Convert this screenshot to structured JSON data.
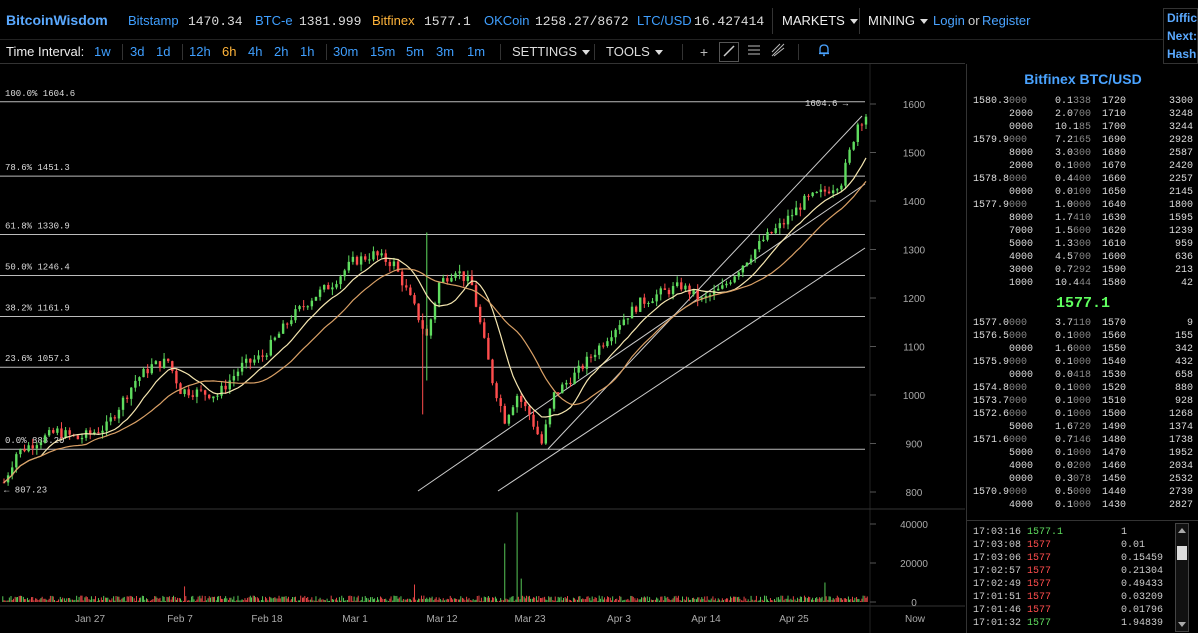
{
  "topbar": {
    "brand": "BitcoinWisdom",
    "exchanges": [
      {
        "name": "Bitstamp",
        "value": "1470.34",
        "active": false
      },
      {
        "name": "BTC-e",
        "value": "1381.999",
        "active": false
      },
      {
        "name": "Bitfinex",
        "value": "1577.1",
        "active": true
      },
      {
        "name": "OKCoin",
        "value": "1258.27/8672",
        "active": false
      },
      {
        "name": "LTC/USD",
        "value": "16.427414",
        "active": false
      }
    ],
    "markets_label": "MARKETS",
    "mining_label": "MINING",
    "login_label": "Login",
    "or_label": "or",
    "register_label": "Register",
    "difficulty_lines": [
      "Difficulty",
      "Next:",
      "Hash"
    ]
  },
  "timebar": {
    "label": "Time Interval:",
    "groups": [
      [
        "1w"
      ],
      [
        "3d",
        "1d"
      ],
      [
        "12h",
        "6h",
        "4h",
        "2h",
        "1h"
      ],
      [
        "30m",
        "15m",
        "5m",
        "3m",
        "1m"
      ]
    ],
    "active": "6h",
    "settings_label": "SETTINGS",
    "tools_label": "TOOLS"
  },
  "chart_data": {
    "type": "candlestick",
    "price_axis": {
      "min": 800,
      "max": 1600,
      "ticks": [
        1600,
        1500,
        1400,
        1300,
        1200,
        1100,
        1000,
        900,
        800
      ]
    },
    "volume_axis": {
      "min": 0,
      "max": 40000,
      "ticks": [
        40000,
        20000,
        0
      ]
    },
    "x_labels": [
      "Jan 27",
      "Feb 7",
      "Feb 18",
      "Mar 1",
      "Mar 12",
      "Mar 23",
      "Apr 3",
      "Apr 14",
      "Apr 25",
      "Now"
    ],
    "fib_levels": [
      {
        "label": "100.0% 1604.6",
        "price": 1604.6
      },
      {
        "label": "78.6% 1451.3",
        "price": 1451.3
      },
      {
        "label": "61.8% 1330.9",
        "price": 1330.9
      },
      {
        "label": "50.0% 1246.4",
        "price": 1246.4
      },
      {
        "label": "38.2% 1161.9",
        "price": 1161.9
      },
      {
        "label": "23.6% 1057.3",
        "price": 1057.3
      },
      {
        "label": "0.0% 888.20",
        "price": 888.2
      }
    ],
    "high_marker": "1604.6",
    "low_marker": "807.23",
    "price_path": [
      [
        0,
        820
      ],
      [
        3,
        880
      ],
      [
        8,
        905
      ],
      [
        13,
        925
      ],
      [
        18,
        910
      ],
      [
        25,
        935
      ],
      [
        32,
        1030
      ],
      [
        36,
        1060
      ],
      [
        40,
        1070
      ],
      [
        43,
        1010
      ],
      [
        48,
        1005
      ],
      [
        52,
        1000
      ],
      [
        58,
        1060
      ],
      [
        63,
        1080
      ],
      [
        70,
        1160
      ],
      [
        75,
        1200
      ],
      [
        80,
        1230
      ],
      [
        85,
        1275
      ],
      [
        90,
        1290
      ],
      [
        95,
        1270
      ],
      [
        100,
        1180
      ],
      [
        103,
        1120
      ],
      [
        106,
        1230
      ],
      [
        110,
        1260
      ],
      [
        114,
        1225
      ],
      [
        119,
        1030
      ],
      [
        122,
        950
      ],
      [
        125,
        1000
      ],
      [
        128,
        960
      ],
      [
        131,
        900
      ],
      [
        134,
        1000
      ],
      [
        140,
        1050
      ],
      [
        145,
        1100
      ],
      [
        150,
        1150
      ],
      [
        155,
        1190
      ],
      [
        160,
        1210
      ],
      [
        165,
        1225
      ],
      [
        170,
        1195
      ],
      [
        175,
        1220
      ],
      [
        180,
        1270
      ],
      [
        185,
        1320
      ],
      [
        190,
        1355
      ],
      [
        195,
        1400
      ],
      [
        200,
        1420
      ],
      [
        204,
        1440
      ],
      [
        208,
        1560
      ],
      [
        210,
        1577
      ]
    ],
    "volume_spikes": [
      [
        44,
        8000
      ],
      [
        100,
        9000
      ],
      [
        122,
        30000
      ],
      [
        125,
        46000
      ],
      [
        126,
        12000
      ],
      [
        200,
        10000
      ]
    ]
  },
  "book": {
    "title": "Bitfinex BTC/USD",
    "asks": [
      [
        "1580.3",
        "000",
        "0.1338",
        "1720",
        "3300"
      ],
      [
        "",
        "2000",
        "2.0700",
        "1710",
        "3248"
      ],
      [
        "",
        "0000",
        "10.185",
        "1700",
        "3244"
      ],
      [
        "1579.9",
        "000",
        "7.2165",
        "1690",
        "2928"
      ],
      [
        "",
        "8000",
        "3.0300",
        "1680",
        "2587"
      ],
      [
        "",
        "2000",
        "0.1000",
        "1670",
        "2420"
      ],
      [
        "1578.8",
        "000",
        "0.4400",
        "1660",
        "2257"
      ],
      [
        "",
        "0000",
        "0.0100",
        "1650",
        "2145"
      ],
      [
        "1577.9",
        "000",
        "1.0000",
        "1640",
        "1800"
      ],
      [
        "",
        "8000",
        "1.7410",
        "1630",
        "1595"
      ],
      [
        "",
        "7000",
        "1.5600",
        "1620",
        "1239"
      ],
      [
        "",
        "5000",
        "1.3300",
        "1610",
        "959"
      ],
      [
        "",
        "4000",
        "4.5700",
        "1600",
        "636"
      ],
      [
        "",
        "3000",
        "0.7292",
        "1590",
        "213"
      ],
      [
        "",
        "1000",
        "10.444",
        "1580",
        "42"
      ]
    ],
    "last": "1577.1",
    "bids": [
      [
        "1577.0",
        "000",
        "3.7110",
        "1570",
        "9"
      ],
      [
        "1576.5",
        "000",
        "0.1000",
        "1560",
        "155"
      ],
      [
        "",
        "0000",
        "1.6000",
        "1550",
        "342"
      ],
      [
        "1575.9",
        "000",
        "0.1000",
        "1540",
        "432"
      ],
      [
        "",
        "0000",
        "0.0418",
        "1530",
        "658"
      ],
      [
        "1574.8",
        "000",
        "0.1000",
        "1520",
        "880"
      ],
      [
        "1573.7",
        "000",
        "0.1000",
        "1510",
        "928"
      ],
      [
        "1572.6",
        "000",
        "0.1000",
        "1500",
        "1268"
      ],
      [
        "",
        "5000",
        "1.6720",
        "1490",
        "1374"
      ],
      [
        "1571.6",
        "000",
        "0.7146",
        "1480",
        "1738"
      ],
      [
        "",
        "5000",
        "0.1000",
        "1470",
        "1952"
      ],
      [
        "",
        "4000",
        "0.0200",
        "1460",
        "2034"
      ],
      [
        "",
        "0000",
        "0.3078",
        "1450",
        "2532"
      ],
      [
        "1570.9",
        "000",
        "0.5000",
        "1440",
        "2739"
      ],
      [
        "",
        "4000",
        "0.1000",
        "1430",
        "2827"
      ]
    ],
    "trades": [
      [
        "17:03:16",
        "1577.1",
        "1",
        "up"
      ],
      [
        "17:03:08",
        "1577",
        "0.01",
        "down"
      ],
      [
        "17:03:06",
        "1577",
        "0.15459",
        "down"
      ],
      [
        "17:02:57",
        "1577",
        "0.21304",
        "down"
      ],
      [
        "17:02:49",
        "1577",
        "0.49433",
        "down"
      ],
      [
        "17:01:51",
        "1577",
        "0.03209",
        "down"
      ],
      [
        "17:01:46",
        "1577",
        "0.01796",
        "down"
      ],
      [
        "17:01:32",
        "1577",
        "1.94839",
        "up"
      ]
    ]
  },
  "colors": {
    "up": "#5fdc5f",
    "down": "#ff4d4d",
    "accent": "#3f9fff",
    "active": "#ffb43a",
    "ma1": "#f5e6b0",
    "ma2": "#d9a066"
  }
}
